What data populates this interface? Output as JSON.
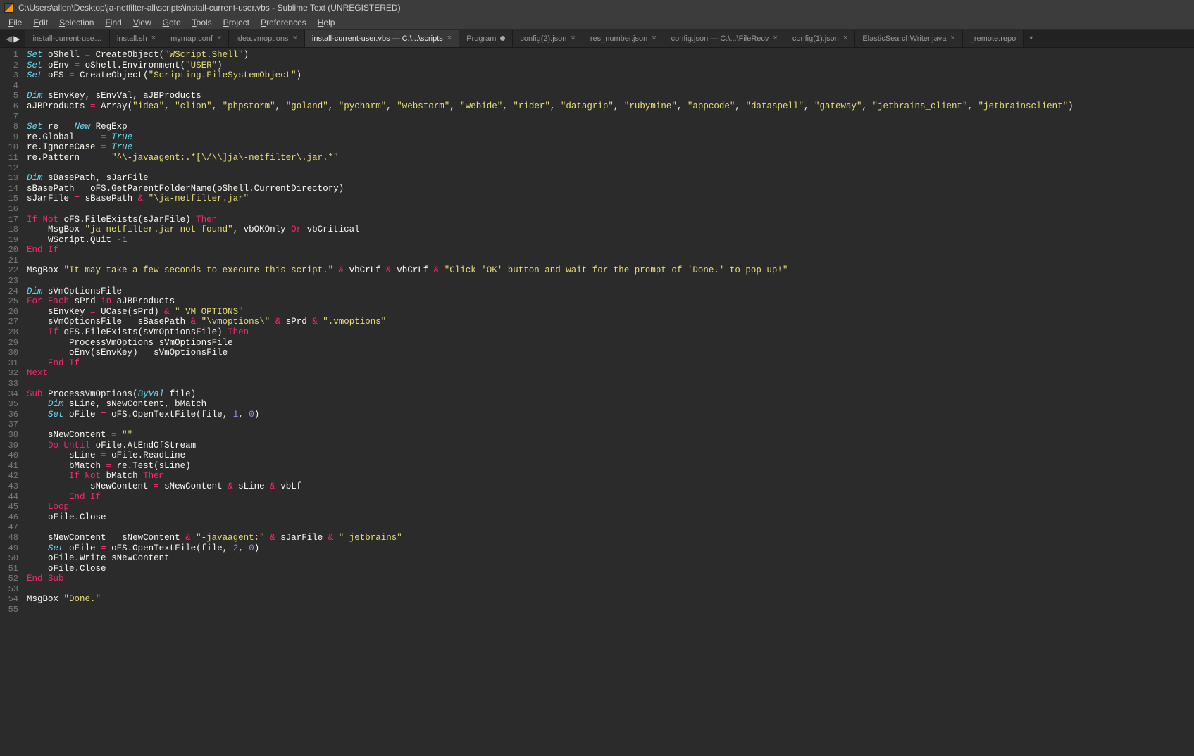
{
  "window": {
    "title": "C:\\Users\\allen\\Desktop\\ja-netfilter-all\\scripts\\install-current-user.vbs - Sublime Text (UNREGISTERED)"
  },
  "menu": {
    "items": [
      "File",
      "Edit",
      "Selection",
      "Find",
      "View",
      "Goto",
      "Tools",
      "Project",
      "Preferences",
      "Help"
    ]
  },
  "tabs": {
    "items": [
      {
        "label": "install-current-use…",
        "close": false,
        "dirty": false,
        "active": false,
        "sub": true
      },
      {
        "label": "install.sh",
        "close": true,
        "dirty": false,
        "active": false
      },
      {
        "label": "mymap.conf",
        "close": true,
        "dirty": false,
        "active": false
      },
      {
        "label": "idea.vmoptions",
        "close": true,
        "dirty": false,
        "active": false
      },
      {
        "label": "install-current-user.vbs — C:\\...\\scripts",
        "close": true,
        "dirty": false,
        "active": true
      },
      {
        "label": "Program",
        "close": false,
        "dirty": true,
        "active": false
      },
      {
        "label": "config(2).json",
        "close": true,
        "dirty": false,
        "active": false
      },
      {
        "label": "res_number.json",
        "close": true,
        "dirty": false,
        "active": false
      },
      {
        "label": "config.json — C:\\...\\FileRecv",
        "close": true,
        "dirty": false,
        "active": false
      },
      {
        "label": "config(1).json",
        "close": true,
        "dirty": false,
        "active": false
      },
      {
        "label": "ElasticSearchWriter.java",
        "close": true,
        "dirty": false,
        "active": false
      },
      {
        "label": "_remote.repo",
        "close": false,
        "dirty": false,
        "active": false
      }
    ]
  },
  "code": {
    "lines": [
      "Set oShell = CreateObject(\"WScript.Shell\")",
      "Set oEnv = oShell.Environment(\"USER\")",
      "Set oFS = CreateObject(\"Scripting.FileSystemObject\")",
      "",
      "Dim sEnvKey, sEnvVal, aJBProducts",
      "aJBProducts = Array(\"idea\", \"clion\", \"phpstorm\", \"goland\", \"pycharm\", \"webstorm\", \"webide\", \"rider\", \"datagrip\", \"rubymine\", \"appcode\", \"dataspell\", \"gateway\", \"jetbrains_client\", \"jetbrainsclient\")",
      "",
      "Set re = New RegExp",
      "re.Global     = True",
      "re.IgnoreCase = True",
      "re.Pattern    = \"^\\-javaagent:.*[\\/\\\\]ja\\-netfilter\\.jar.*\"",
      "",
      "Dim sBasePath, sJarFile",
      "sBasePath = oFS.GetParentFolderName(oShell.CurrentDirectory)",
      "sJarFile = sBasePath & \"\\ja-netfilter.jar\"",
      "",
      "If Not oFS.FileExists(sJarFile) Then",
      "    MsgBox \"ja-netfilter.jar not found\", vbOKOnly Or vbCritical",
      "    WScript.Quit -1",
      "End If",
      "",
      "MsgBox \"It may take a few seconds to execute this script.\" & vbCrLf & vbCrLf & \"Click 'OK' button and wait for the prompt of 'Done.' to pop up!\"",
      "",
      "Dim sVmOptionsFile",
      "For Each sPrd in aJBProducts",
      "    sEnvKey = UCase(sPrd) & \"_VM_OPTIONS\"",
      "    sVmOptionsFile = sBasePath & \"\\vmoptions\\\" & sPrd & \".vmoptions\"",
      "    If oFS.FileExists(sVmOptionsFile) Then",
      "        ProcessVmOptions sVmOptionsFile",
      "        oEnv(sEnvKey) = sVmOptionsFile",
      "    End If",
      "Next",
      "",
      "Sub ProcessVmOptions(ByVal file)",
      "    Dim sLine, sNewContent, bMatch",
      "    Set oFile = oFS.OpenTextFile(file, 1, 0)",
      "",
      "    sNewContent = \"\"",
      "    Do Until oFile.AtEndOfStream",
      "        sLine = oFile.ReadLine",
      "        bMatch = re.Test(sLine)",
      "        If Not bMatch Then",
      "            sNewContent = sNewContent & sLine & vbLf",
      "        End If",
      "    Loop",
      "    oFile.Close",
      "",
      "    sNewContent = sNewContent & \"-javaagent:\" & sJarFile & \"=jetbrains\"",
      "    Set oFile = oFS.OpenTextFile(file, 2, 0)",
      "    oFile.Write sNewContent",
      "    oFile.Close",
      "End Sub",
      "",
      "MsgBox \"Done.\"",
      ""
    ]
  }
}
